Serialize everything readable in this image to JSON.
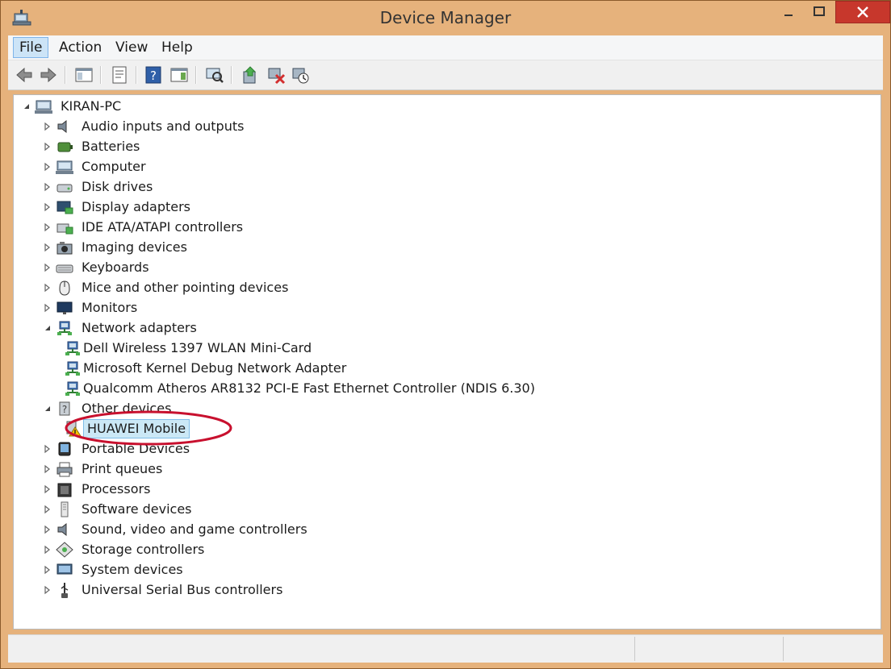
{
  "window": {
    "title": "Device Manager",
    "accent_color": "#e6b27c",
    "close_button_color": "#c7372c"
  },
  "menu": [
    {
      "label": "File",
      "active": true
    },
    {
      "label": "Action"
    },
    {
      "label": "View"
    },
    {
      "label": "Help"
    }
  ],
  "toolbar": {
    "buttons": [
      "back-icon",
      "forward-icon",
      "show-hide-console-tree-icon",
      "properties-icon",
      "help-icon",
      "action-pane-icon",
      "scan-hardware-icon",
      "update-driver-icon",
      "disable-device-icon",
      "uninstall-device-icon"
    ]
  },
  "tree": {
    "root": "KIRAN-PC",
    "items": [
      {
        "label": "Audio inputs and outputs",
        "icon": "speaker-icon"
      },
      {
        "label": "Batteries",
        "icon": "battery-icon"
      },
      {
        "label": "Computer",
        "icon": "computer-icon"
      },
      {
        "label": "Disk drives",
        "icon": "disk-drive-icon"
      },
      {
        "label": "Display adapters",
        "icon": "display-adapter-icon"
      },
      {
        "label": "IDE ATA/ATAPI controllers",
        "icon": "ide-controller-icon"
      },
      {
        "label": "Imaging devices",
        "icon": "camera-icon"
      },
      {
        "label": "Keyboards",
        "icon": "keyboard-icon"
      },
      {
        "label": "Mice and other pointing devices",
        "icon": "mouse-icon"
      },
      {
        "label": "Monitors",
        "icon": "monitor-icon"
      },
      {
        "label": "Network adapters",
        "icon": "network-adapter-icon",
        "expanded": true
      },
      {
        "label": "Dell Wireless 1397 WLAN Mini-Card",
        "icon": "network-adapter-icon",
        "child": true
      },
      {
        "label": "Microsoft Kernel Debug Network Adapter",
        "icon": "network-adapter-icon",
        "child": true
      },
      {
        "label": "Qualcomm Atheros AR8132 PCI-E Fast Ethernet Controller (NDIS 6.30)",
        "icon": "network-adapter-icon",
        "child": true
      },
      {
        "label": "Other devices",
        "icon": "unknown-device-icon",
        "expanded": true
      },
      {
        "label": "HUAWEI Mobile",
        "icon": "warning-device-icon",
        "child": true,
        "selected": true
      },
      {
        "label": "Portable Devices",
        "icon": "portable-device-icon"
      },
      {
        "label": "Print queues",
        "icon": "printer-icon"
      },
      {
        "label": "Processors",
        "icon": "processor-icon"
      },
      {
        "label": "Software devices",
        "icon": "software-device-icon"
      },
      {
        "label": "Sound, video and game controllers",
        "icon": "speaker-icon"
      },
      {
        "label": "Storage controllers",
        "icon": "storage-controller-icon"
      },
      {
        "label": "System devices",
        "icon": "system-device-icon"
      },
      {
        "label": "Universal Serial Bus controllers",
        "icon": "usb-icon"
      }
    ]
  },
  "annotation": {
    "color": "#c8102e"
  }
}
